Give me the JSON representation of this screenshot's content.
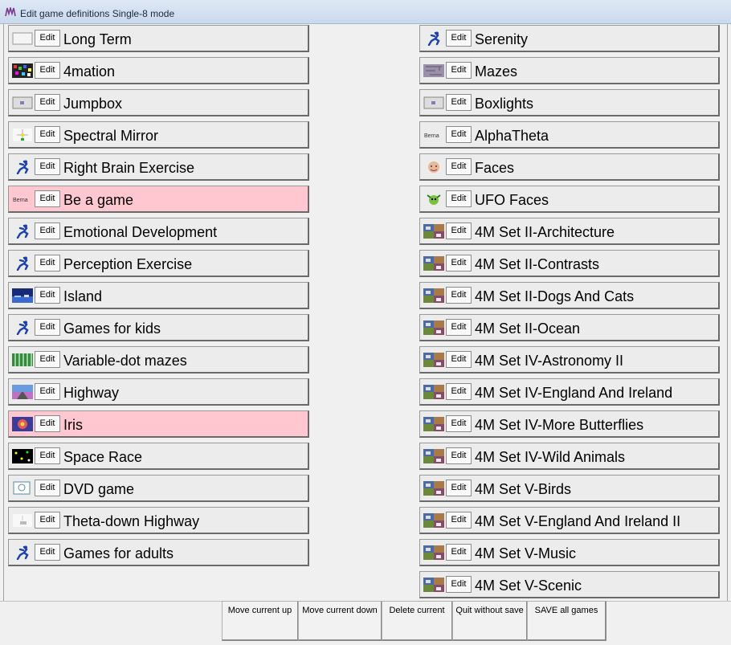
{
  "window": {
    "title": "Edit game definitions Single-8 mode"
  },
  "edit_label": "Edit",
  "left_games": [
    {
      "name": "Long Term",
      "icon": "blank-screen",
      "highlighted": false
    },
    {
      "name": "4mation",
      "icon": "pixel-mosaic",
      "highlighted": false
    },
    {
      "name": "Jumpbox",
      "icon": "small-box",
      "highlighted": false
    },
    {
      "name": "Spectral Mirror",
      "icon": "spark",
      "highlighted": false
    },
    {
      "name": "Right Brain Exercise",
      "icon": "blue-runner",
      "highlighted": false
    },
    {
      "name": "Be a game",
      "icon": "text-logo",
      "highlighted": true
    },
    {
      "name": "Emotional Development",
      "icon": "blue-runner",
      "highlighted": false
    },
    {
      "name": "Perception Exercise",
      "icon": "blue-runner",
      "highlighted": false
    },
    {
      "name": "Island",
      "icon": "water-scene",
      "highlighted": false
    },
    {
      "name": "Games for kids",
      "icon": "blue-runner",
      "highlighted": false
    },
    {
      "name": "Variable-dot mazes",
      "icon": "green-grid",
      "highlighted": false
    },
    {
      "name": "Highway",
      "icon": "road-scene",
      "highlighted": false
    },
    {
      "name": "Iris",
      "icon": "flower",
      "highlighted": true
    },
    {
      "name": "Space Race",
      "icon": "space-dots",
      "highlighted": false
    },
    {
      "name": "DVD game",
      "icon": "dvd-logo",
      "highlighted": false
    },
    {
      "name": "Theta-down Highway",
      "icon": "faint-screen",
      "highlighted": false
    },
    {
      "name": "Games for adults",
      "icon": "blue-runner",
      "highlighted": false
    }
  ],
  "right_games": [
    {
      "name": "Serenity",
      "icon": "blue-runner",
      "highlighted": false
    },
    {
      "name": "Mazes",
      "icon": "maze",
      "highlighted": false
    },
    {
      "name": "Boxlights",
      "icon": "small-box",
      "highlighted": false
    },
    {
      "name": "AlphaTheta",
      "icon": "text-logo",
      "highlighted": false
    },
    {
      "name": "Faces",
      "icon": "face",
      "highlighted": false
    },
    {
      "name": "UFO Faces",
      "icon": "ufo-face",
      "highlighted": false
    },
    {
      "name": "4M Set II-Architecture",
      "icon": "photo-collage",
      "highlighted": false
    },
    {
      "name": "4M Set II-Contrasts",
      "icon": "photo-collage",
      "highlighted": false
    },
    {
      "name": "4M Set II-Dogs And Cats",
      "icon": "photo-collage",
      "highlighted": false
    },
    {
      "name": "4M Set II-Ocean",
      "icon": "photo-collage",
      "highlighted": false
    },
    {
      "name": "4M Set IV-Astronomy II",
      "icon": "photo-collage",
      "highlighted": false
    },
    {
      "name": "4M Set IV-England And Ireland",
      "icon": "photo-collage",
      "highlighted": false
    },
    {
      "name": "4M Set IV-More Butterflies",
      "icon": "photo-collage",
      "highlighted": false
    },
    {
      "name": "4M Set IV-Wild Animals",
      "icon": "photo-collage",
      "highlighted": false
    },
    {
      "name": "4M Set V-Birds",
      "icon": "photo-collage",
      "highlighted": false
    },
    {
      "name": "4M Set V-England And Ireland II",
      "icon": "photo-collage",
      "highlighted": false
    },
    {
      "name": "4M Set V-Music",
      "icon": "photo-collage",
      "highlighted": false
    },
    {
      "name": "4M Set V-Scenic",
      "icon": "photo-collage",
      "highlighted": false
    }
  ],
  "bottom_buttons": {
    "move_up": "Move current up",
    "move_down": "Move current down",
    "delete": "Delete current",
    "quit": "Quit without save",
    "save": "SAVE all games"
  },
  "colors": {
    "highlight": "#ffc8d0",
    "button_face": "#ececec"
  }
}
